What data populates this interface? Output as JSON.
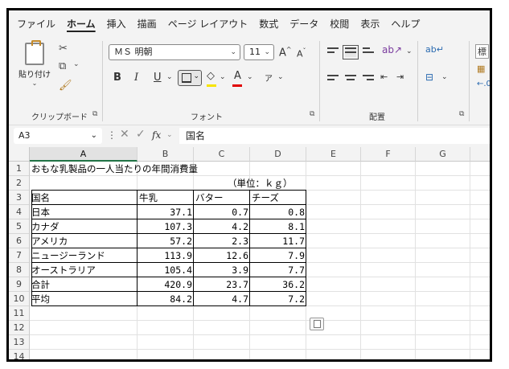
{
  "ribbon": {
    "tabs": [
      "ファイル",
      "ホーム",
      "挿入",
      "描画",
      "ページ レイアウト",
      "数式",
      "データ",
      "校閲",
      "表示",
      "ヘルプ"
    ],
    "active_tab": "ホーム",
    "groups": {
      "clipboard": {
        "label": "クリップボード",
        "paste_label": "貼り付け"
      },
      "font": {
        "label": "フォント",
        "font_name": "ＭＳ 明朝",
        "font_size": "11"
      },
      "alignment": {
        "label": "配置"
      },
      "styles": {
        "partial_label": "標"
      }
    }
  },
  "formula_bar": {
    "cell_ref": "A3",
    "fx": "fx",
    "content": "国名"
  },
  "grid": {
    "columns": [
      "A",
      "B",
      "C",
      "D",
      "E",
      "F",
      "G"
    ],
    "rows": [
      "1",
      "2",
      "3",
      "4",
      "5",
      "6",
      "7",
      "8",
      "9",
      "10",
      "11",
      "12",
      "13",
      "14"
    ],
    "selected_column": "A",
    "title": "おもな乳製品の一人当たりの年間消費量",
    "unit": "（単位：ｋｇ）",
    "table_headers": [
      "国名",
      "牛乳",
      "バター",
      "チーズ"
    ],
    "table_rows": [
      [
        "日本",
        "37.1",
        "0.7",
        "0.8"
      ],
      [
        "カナダ",
        "107.3",
        "4.2",
        "8.1"
      ],
      [
        "アメリカ",
        "57.2",
        "2.3",
        "11.7"
      ],
      [
        "ニュージーランド",
        "113.9",
        "12.6",
        "7.9"
      ],
      [
        "オーストラリア",
        "105.4",
        "3.9",
        "7.7"
      ],
      [
        "合計",
        "420.9",
        "23.7",
        "36.2"
      ],
      [
        "平均",
        "84.2",
        "4.7",
        "7.2"
      ]
    ]
  }
}
